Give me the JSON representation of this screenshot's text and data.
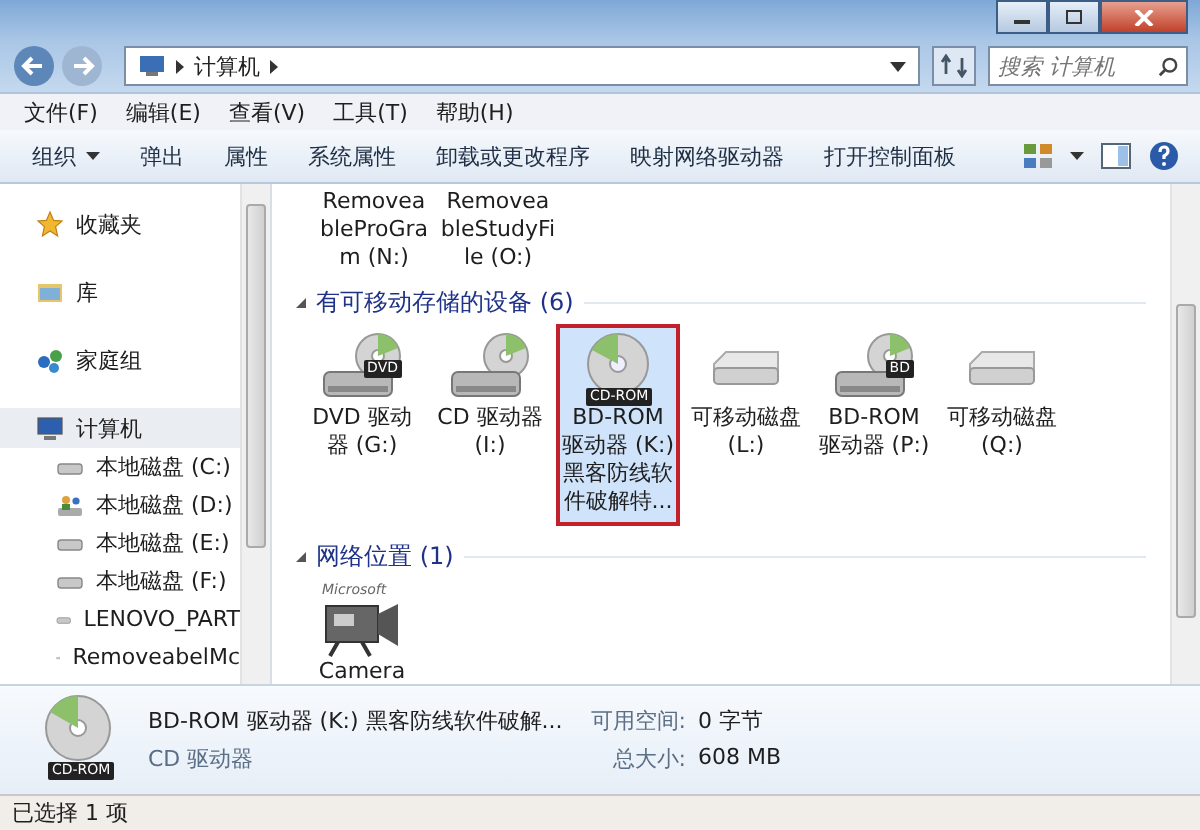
{
  "address": {
    "breadcrumb": [
      "计算机"
    ],
    "search_placeholder": "搜索 计算机"
  },
  "menu": [
    "文件(F)",
    "编辑(E)",
    "查看(V)",
    "工具(T)",
    "帮助(H)"
  ],
  "toolbar": [
    {
      "label": "组织",
      "dropdown": true
    },
    {
      "label": "弹出",
      "dropdown": false
    },
    {
      "label": "属性",
      "dropdown": false
    },
    {
      "label": "系统属性",
      "dropdown": false
    },
    {
      "label": "卸载或更改程序",
      "dropdown": false
    },
    {
      "label": "映射网络驱动器",
      "dropdown": false
    },
    {
      "label": "打开控制面板",
      "dropdown": false
    }
  ],
  "sidebar": [
    {
      "label": "收藏夹",
      "kind": "star",
      "selected": false
    },
    {
      "label": "库",
      "kind": "library",
      "selected": false
    },
    {
      "label": "家庭组",
      "kind": "homegroup",
      "selected": false
    },
    {
      "label": "计算机",
      "kind": "computer",
      "selected": true,
      "children": [
        {
          "label": "本地磁盘 (C:)",
          "kind": "disk",
          "selected": false
        },
        {
          "label": "本地磁盘 (D:)",
          "kind": "user",
          "selected": false
        },
        {
          "label": "本地磁盘 (E:)",
          "kind": "disk",
          "selected": false
        },
        {
          "label": "本地磁盘 (F:)",
          "kind": "disk",
          "selected": false
        },
        {
          "label": "LENOVO_PART",
          "kind": "disk",
          "selected": false
        },
        {
          "label": "RemoveabelMc",
          "kind": "disk",
          "selected": false
        }
      ]
    }
  ],
  "top_items": [
    "RemoveableProGram (N:)",
    "RemoveableStudyFile (O:)"
  ],
  "groups": [
    {
      "title": "有可移动存储的设备 (6)",
      "items": [
        {
          "label": "DVD 驱动器 (G:)",
          "kind": "optical",
          "badge": "DVD",
          "selected": false
        },
        {
          "label": "CD 驱动器 (I:)",
          "kind": "optical",
          "selected": false
        },
        {
          "label": "BD-ROM 驱动器 (K:) 黑客防线软件破解特...",
          "kind": "disc",
          "badge": "CD-ROM",
          "selected": true
        },
        {
          "label": "可移动磁盘 (L:)",
          "kind": "removable",
          "selected": false
        },
        {
          "label": "BD-ROM 驱动器 (P:)",
          "kind": "optical",
          "badge": "BD",
          "selected": false
        },
        {
          "label": "可移动磁盘 (Q:)",
          "kind": "removable",
          "selected": false
        }
      ]
    },
    {
      "title": "网络位置 (1)",
      "items": [
        {
          "label": "Camera",
          "kind": "camera",
          "badge": "Microsoft",
          "selected": false
        }
      ]
    }
  ],
  "details": {
    "badge": "CD-ROM",
    "name": "BD-ROM 驱动器 (K:) 黑客防线软件破解...",
    "type": "CD 驱动器",
    "fields": [
      {
        "label": "可用空间:",
        "value": "0 字节"
      },
      {
        "label": "总大小:",
        "value": "608 MB"
      }
    ]
  },
  "status": "已选择 1 项"
}
